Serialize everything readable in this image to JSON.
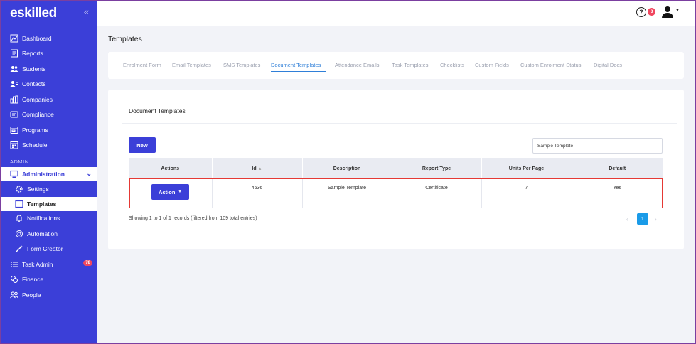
{
  "app": {
    "logo_text": "eskilled",
    "collapse_icon": "double-chevron-left-icon"
  },
  "sidebar": {
    "main_items": [
      {
        "label": "Dashboard",
        "icon": "chart-line-icon"
      },
      {
        "label": "Reports",
        "icon": "report-icon"
      },
      {
        "label": "Students",
        "icon": "users-icon"
      },
      {
        "label": "Contacts",
        "icon": "contact-card-icon"
      },
      {
        "label": "Companies",
        "icon": "building-icon"
      },
      {
        "label": "Compliance",
        "icon": "compliance-icon"
      },
      {
        "label": "Programs",
        "icon": "programs-icon"
      },
      {
        "label": "Schedule",
        "icon": "schedule-icon"
      }
    ],
    "section_label": "ADMIN",
    "admin_label": "Administration",
    "admin_sub_items": [
      {
        "label": "Settings",
        "icon": "gear-icon"
      },
      {
        "label": "Templates",
        "icon": "template-icon"
      },
      {
        "label": "Notifications",
        "icon": "bell-icon"
      },
      {
        "label": "Automation",
        "icon": "automation-icon"
      },
      {
        "label": "Form Creator",
        "icon": "magic-wand-icon"
      }
    ],
    "lower_items": [
      {
        "label": "Task Admin",
        "icon": "list-icon",
        "badge": "78"
      },
      {
        "label": "Finance",
        "icon": "coins-icon"
      },
      {
        "label": "People",
        "icon": "people-icon"
      }
    ]
  },
  "topbar": {
    "help_symbol": "?",
    "notification_count": "3"
  },
  "page": {
    "title": "Templates",
    "tabs": [
      "Enrolment Form",
      "Email Templates",
      "SMS Templates",
      "Document Templates",
      "Attendance Emails",
      "Task Templates",
      "Checklists",
      "Custom Fields",
      "Custom Enrolment Status",
      "Digital Docs"
    ],
    "active_tab": "Document Templates"
  },
  "card": {
    "title": "Document Templates",
    "new_button": "New",
    "search_value": "Sample Template",
    "columns": [
      "Actions",
      "Id",
      "Description",
      "Report Type",
      "Units Per Page",
      "Default"
    ],
    "rows": [
      {
        "action": "Action",
        "id": "4636",
        "description": "Sample Template",
        "report_type": "Certificate",
        "units_per_page": "7",
        "default": "Yes"
      }
    ],
    "showing_text": "Showing 1 to 1 of 1 records (filtered from 109 total entries)",
    "pager": {
      "prev": "‹",
      "current": "1",
      "next": "›"
    }
  },
  "colors": {
    "sidebar": "#3b3fd8",
    "primary_button": "#3b3fd8",
    "active_tab": "#2f7fd8",
    "pager_active": "#1a9be8",
    "badge": "#f0475f",
    "highlight": "#e53935"
  }
}
